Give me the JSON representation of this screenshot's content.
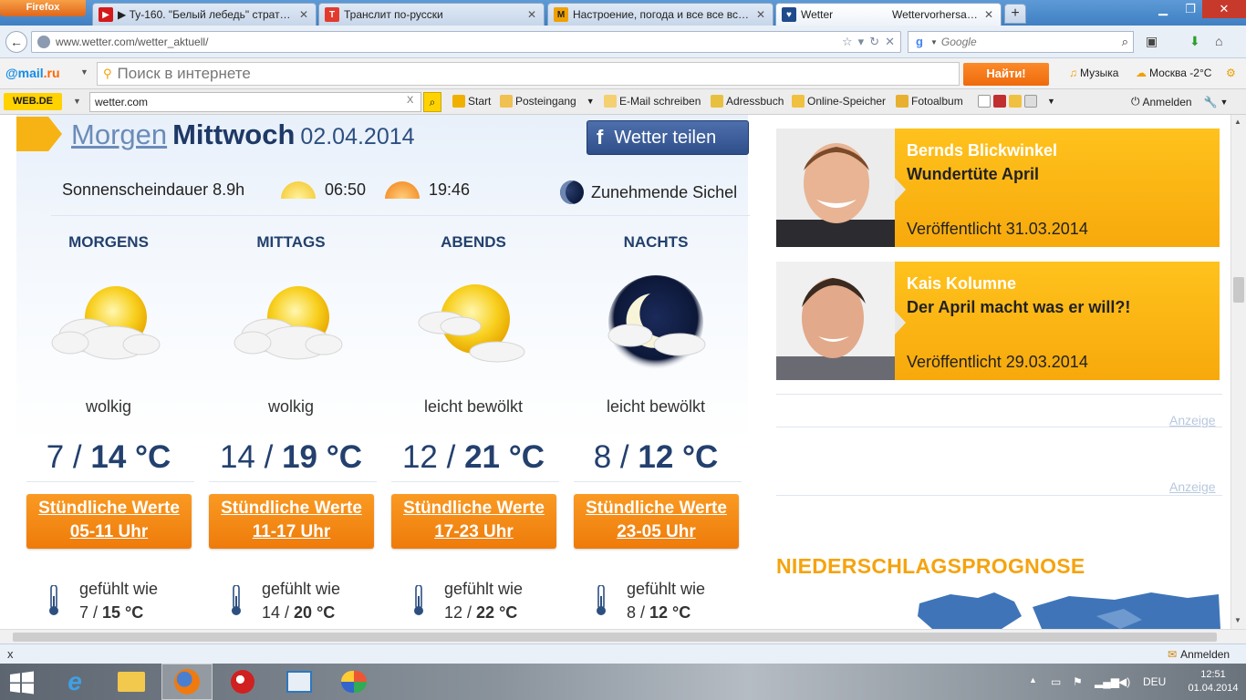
{
  "browser": {
    "menu_label": "Firefox",
    "tabs": [
      {
        "label": "▶ Ту-160. \"Белый лебедь\" стратеги...",
        "icon": "youtube-icon"
      },
      {
        "label": "Транслит по-русски",
        "icon": "translit-icon"
      },
      {
        "label": "Настроение, погода и все все все (ч...",
        "icon": "m-icon"
      },
      {
        "label": "Wetter",
        "label2": "Wettervorhersage ...",
        "icon": "wetter-icon"
      }
    ],
    "url": "www.wetter.com/wetter_aktuell/",
    "search_placeholder": "Google",
    "search_engine": "g"
  },
  "mailru": {
    "logo": "@mail",
    "logo_suffix": ".ru",
    "search_placeholder": "Поиск в интернете",
    "find_label": "Найти!",
    "music_label": "Музыка",
    "weather_label": "Москва -2°C"
  },
  "webde": {
    "logo": "WEB.DE",
    "search_value": "wetter.com",
    "clear": "X",
    "items": [
      "Start",
      "Posteingang",
      "E-Mail schreiben",
      "Adressbuch",
      "Online-Speicher",
      "Fotoalbum"
    ],
    "anmelden": "Anmelden"
  },
  "forecast": {
    "morgen_link": "Morgen",
    "weekday": "Mittwoch",
    "date": "02.04.2014",
    "share_label": "Wetter teilen",
    "sunshine": "Sonnenscheindauer 8.9h",
    "sunrise": "06:50",
    "sunset": "19:46",
    "moon_phase": "Zunehmende Sichel",
    "periods": [
      {
        "name": "MORGENS",
        "icon": "cloudy-sun-icon",
        "desc": "wolkig",
        "tmin": "7",
        "tmax": "14 °C",
        "btn1": "Stündliche Werte",
        "btn2": "05-11 Uhr",
        "feels_label": "gefühlt wie",
        "feels_min": "7",
        "feels_max": "15 °C"
      },
      {
        "name": "MITTAGS",
        "icon": "cloudy-sun-icon",
        "desc": "wolkig",
        "tmin": "14",
        "tmax": "19 °C",
        "btn1": "Stündliche Werte",
        "btn2": "11-17 Uhr",
        "feels_label": "gefühlt wie",
        "feels_min": "14",
        "feels_max": "20 °C"
      },
      {
        "name": "ABENDS",
        "icon": "partly-cloudy-sun-icon",
        "desc": "leicht bewölkt",
        "tmin": "12",
        "tmax": "21 °C",
        "btn1": "Stündliche Werte",
        "btn2": "17-23 Uhr",
        "feels_label": "gefühlt wie",
        "feels_min": "12",
        "feels_max": "22 °C"
      },
      {
        "name": "NACHTS",
        "icon": "cloudy-moon-icon",
        "desc": "leicht bewölkt",
        "tmin": "8",
        "tmax": "12 °C",
        "btn1": "Stündliche Werte",
        "btn2": "23-05 Uhr",
        "feels_label": "gefühlt wie",
        "feels_min": "8",
        "feels_max": "12 °C"
      }
    ]
  },
  "sidebar": {
    "articles": [
      {
        "title": "Bernds Blickwinkel",
        "subtitle": "Wundertüte April",
        "date": "Veröffentlicht 31.03.2014"
      },
      {
        "title": "Kais Kolumne",
        "subtitle": "Der April macht was er will?!",
        "date": "Veröffentlicht 29.03.2014"
      }
    ],
    "ad_label": "Anzeige",
    "precip_heading": "NIEDERSCHLAGSPROGNOSE"
  },
  "addon": {
    "close": "x",
    "anmelden": "Anmelden"
  },
  "taskbar": {
    "language": "DEU",
    "time": "12:51",
    "date": "01.04.2014"
  },
  "colors": {
    "accent_orange": "#f59a1b",
    "heading_blue": "#1e3966",
    "sidebar_yellow": "#ffc21d"
  }
}
